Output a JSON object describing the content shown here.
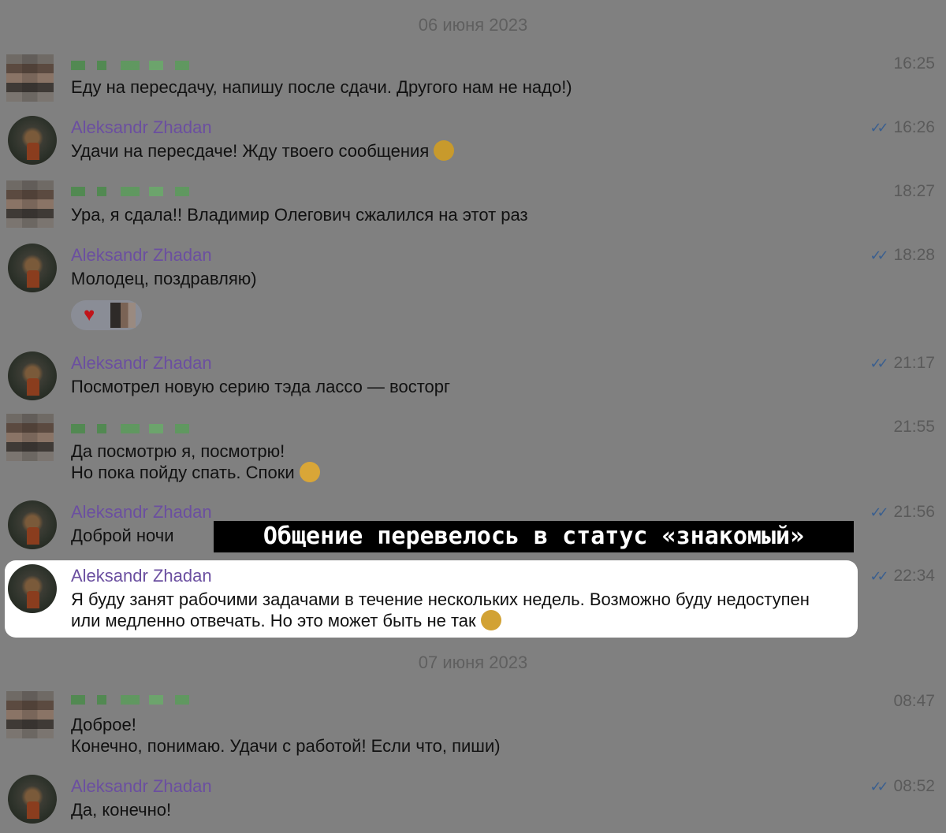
{
  "dates": [
    "06 июня 2023",
    "07 июня 2023"
  ],
  "sender_name": "Aleksandr Zhadan",
  "messages": [
    {
      "time": "16:25",
      "text": "Еду на пересдачу, напишу после сдачи. Другого нам не надо!)"
    },
    {
      "time": "16:26",
      "text": "Удачи на пересдаче! Жду твоего сообщения",
      "emoji": "slightly-smiling-face"
    },
    {
      "time": "18:27",
      "text": "Ура, я сдала!! Владимир Олегович сжалился на этот раз"
    },
    {
      "time": "18:28",
      "text": "Молодец, поздравляю)"
    },
    {
      "time": "21:17",
      "text": "Посмотрел новую серию тэда лассо — восторг"
    },
    {
      "time": "21:55",
      "line1": "Да посмотрю я, посмотрю!",
      "line2": "Но пока пойду спать. Споки",
      "emoji": "sleeping-face"
    },
    {
      "time": "21:56",
      "text": "Доброй ночи"
    },
    {
      "time": "22:34",
      "line1": "Я буду занят рабочими задачами в течение нескольких недель. Возможно буду недоступен",
      "line2": "или медленно отвечать. Но это может быть не так",
      "emoji": "thinking-face"
    },
    {
      "time": "08:47",
      "line1": "Доброе!",
      "line2": "Конечно, понимаю. Удачи с работой! Если что, пиши)"
    },
    {
      "time": "08:52",
      "text": "Да, конечно!"
    }
  ],
  "reaction": {
    "emoji": "♥",
    "icon": "heart-icon"
  },
  "check_mark": "✓✓",
  "banner_text": "Общение перевелось в статус «знакомый»",
  "colors": {
    "background": "#808080",
    "sender": "#6b4fa0",
    "highlight": "#ffffff",
    "banner": "#000000"
  }
}
